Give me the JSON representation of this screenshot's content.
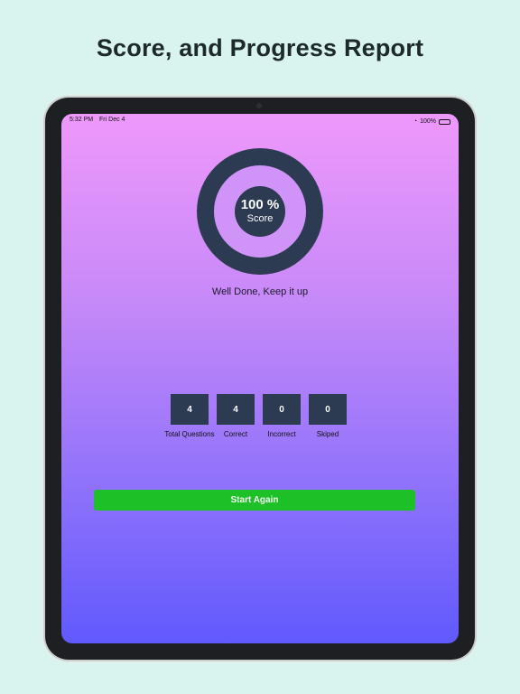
{
  "headline": "Score, and Progress Report",
  "status_bar": {
    "time": "5:32 PM",
    "date": "Fri Dec 4",
    "battery": "100%"
  },
  "score": {
    "percent_label": "100 %",
    "label": "Score"
  },
  "message": "Well Done, Keep it up",
  "stats": [
    {
      "value": "4",
      "label": "Total Questions"
    },
    {
      "value": "4",
      "label": "Correct"
    },
    {
      "value": "0",
      "label": "Incorrect"
    },
    {
      "value": "0",
      "label": "Skiped"
    }
  ],
  "start_button": {
    "label": "Start Again"
  },
  "colors": {
    "background": "#d9f3ee",
    "accent_dark": "#2c3a52",
    "button_green": "#1ec028",
    "gradient_top": "#ee98fb",
    "gradient_bottom": "#6159fd"
  }
}
